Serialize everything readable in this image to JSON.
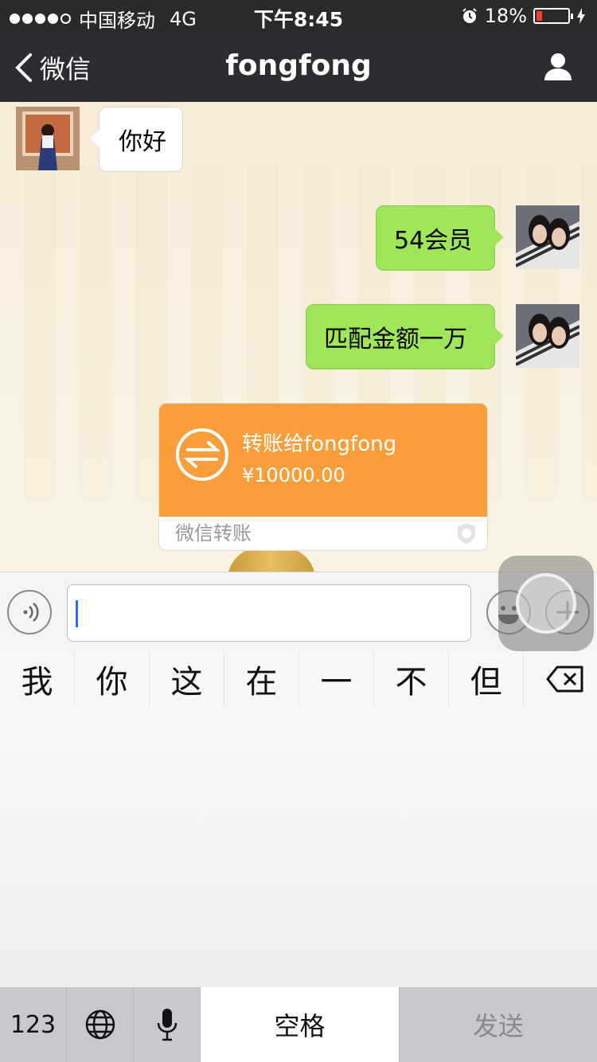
{
  "status_bar": {
    "carrier": "中国移动",
    "network": "4G",
    "time": "下午8:45",
    "battery": "18%",
    "battery_level": 0.18
  },
  "nav": {
    "back_label": "微信",
    "title": "fongfong"
  },
  "messages": [
    {
      "side": "left",
      "text": "你好"
    },
    {
      "side": "right",
      "text": "54会员"
    },
    {
      "side": "right",
      "text": "匹配金额一万"
    }
  ],
  "transfer": {
    "title": "转账给fongfong",
    "amount": "¥10000.00",
    "footer": "微信转账"
  },
  "candidates": [
    "我",
    "你",
    "这",
    "在",
    "一",
    "不",
    "但"
  ],
  "keyboard": {
    "numbers_key": "123",
    "space_key": "空格",
    "send_key": "发送"
  },
  "colors": {
    "nav_bg": "#2d2c30",
    "bubble_green": "#9fe658",
    "transfer_orange": "#f99e3a",
    "battery_low": "#ff3b30",
    "caret_blue": "#2f6bff"
  },
  "icons": [
    "back-chevron-icon",
    "profile-icon",
    "alarm-icon",
    "charging-icon",
    "transfer-arrows-icon",
    "shield-icon",
    "voice-icon",
    "emoji-icon",
    "plus-icon",
    "delete-icon",
    "globe-icon",
    "microphone-icon"
  ]
}
